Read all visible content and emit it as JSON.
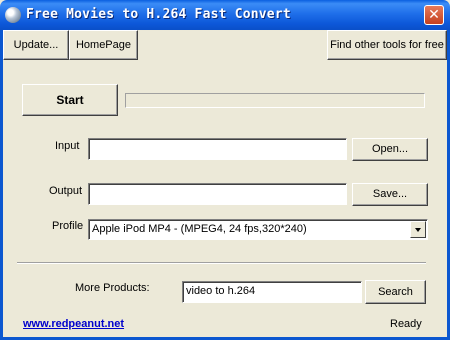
{
  "window": {
    "title": "Free Movies to H.264 Fast Convert"
  },
  "toolbar": {
    "update_label": "Update...",
    "homepage_label": "HomePage",
    "other_tools_label": "Find other tools for free"
  },
  "convert": {
    "start_label": "Start",
    "progress": 0
  },
  "input": {
    "label": "Input",
    "value": "",
    "open_label": "Open..."
  },
  "output": {
    "label": "Output",
    "value": "",
    "save_label": "Save..."
  },
  "profile": {
    "label": "Profile",
    "selected": "Apple iPod MP4 - (MPEG4, 24 fps,320*240)"
  },
  "more_products": {
    "label": "More Products:",
    "value": "video to h.264",
    "search_label": "Search"
  },
  "footer": {
    "link": "www.redpeanut.net",
    "status": "Ready"
  }
}
